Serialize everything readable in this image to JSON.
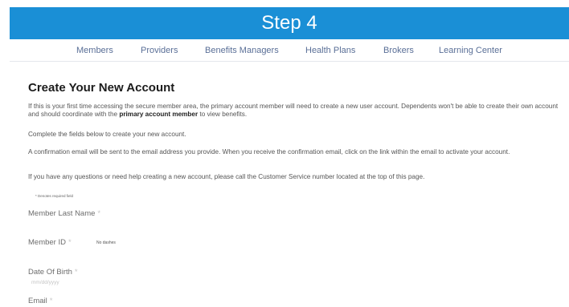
{
  "banner": {
    "title": "Step 4"
  },
  "nav": {
    "items": [
      {
        "label": "Members"
      },
      {
        "label": "Providers"
      },
      {
        "label": "Benefits Managers"
      },
      {
        "label": "Health Plans"
      },
      {
        "label": "Brokers"
      },
      {
        "label": "Learning Center"
      }
    ]
  },
  "content": {
    "heading": "Create Your New Account",
    "intro_part1": "If this is your first time accessing the secure member area, the primary account member will need to create a new user account. Dependents won't be able to create their own account and should coordinate with the ",
    "intro_bold": "primary account member",
    "intro_part2": " to view benefits.",
    "complete_text": "Complete the fields below to create your new account.",
    "confirmation_text": "A confirmation email will be sent to the email address you provide. When you receive the confirmation email, click on the link within the email to activate your account.",
    "help_text": "If you have any questions or need help creating a new account, please call the Customer Service number located at the top of this page.",
    "required_note": "* Denotes required field"
  },
  "form": {
    "required_marker": "*",
    "last_name_label": "Member Last Name",
    "member_id_label": "Member ID",
    "member_id_hint": "No dashes",
    "dob_label": "Date Of Birth",
    "dob_hint": "mm/dd/yyyy",
    "email_label": "Email"
  }
}
